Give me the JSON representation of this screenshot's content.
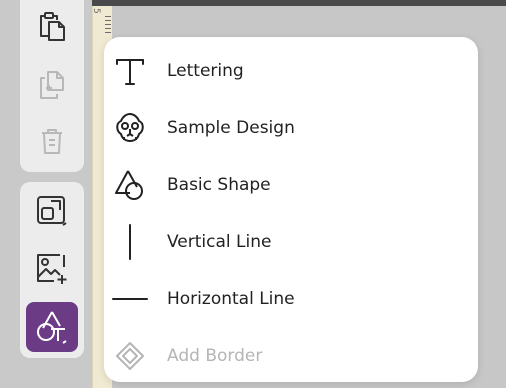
{
  "toolbar": {
    "buttons": [
      {
        "icon": "paste-icon",
        "state": "enabled"
      },
      {
        "icon": "duplicate-icon",
        "state": "disabled"
      },
      {
        "icon": "trash-icon",
        "state": "disabled"
      },
      {
        "icon": "resize-icon",
        "state": "enabled"
      },
      {
        "icon": "add-image-icon",
        "state": "enabled"
      },
      {
        "icon": "shape-text-icon",
        "state": "active"
      }
    ],
    "active_color": "#6b3b86"
  },
  "ruler": {
    "label": "5"
  },
  "menu": {
    "items": [
      {
        "label": "Lettering",
        "icon": "lettering-t-icon",
        "enabled": true
      },
      {
        "label": "Sample Design",
        "icon": "sample-design-icon",
        "enabled": true
      },
      {
        "label": "Basic Shape",
        "icon": "basic-shape-icon",
        "enabled": true
      },
      {
        "label": "Vertical Line",
        "icon": "vertical-line-icon",
        "enabled": true
      },
      {
        "label": "Horizontal Line",
        "icon": "horizontal-line-icon",
        "enabled": true
      },
      {
        "label": "Add Border",
        "icon": "add-border-icon",
        "enabled": false
      }
    ]
  }
}
